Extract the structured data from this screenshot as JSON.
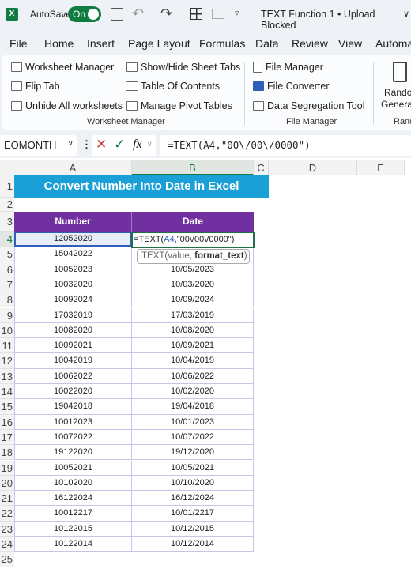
{
  "titlebar": {
    "autosave_label": "AutoSave",
    "toggle_label": "On",
    "doc_title": "TEXT Function 1 • Upload Blocked",
    "chevron": "∨"
  },
  "tabs": [
    "File",
    "Home",
    "Insert",
    "Page Layout",
    "Formulas",
    "Data",
    "Review",
    "View",
    "Automa"
  ],
  "ribbon": {
    "worksheet_group": {
      "label": "Worksheet Manager",
      "items": [
        "Worksheet Manager",
        "Flip Tab",
        "Unhide All worksheets",
        "Show/Hide Sheet Tabs",
        "Table Of Contents",
        "Manage Pivot Tables"
      ]
    },
    "file_group": {
      "label": "File Manager",
      "items": [
        "File Manager",
        "File Converter",
        "Data Segregation Tool"
      ]
    },
    "random_group": {
      "label": "Rand",
      "button_line1": "Randon",
      "button_line2": "Generat"
    }
  },
  "formula_bar": {
    "name_box": "EOMONTH",
    "fx": "fx",
    "formula": "=TEXT(A4,\"00\\/00\\/0000\")"
  },
  "columns": [
    "A",
    "B",
    "C",
    "D",
    "E"
  ],
  "sheet": {
    "title": "Convert Number Into Date in Excel",
    "headers": [
      "Number",
      "Date"
    ],
    "editing_formula_prefix": "=TEXT(",
    "editing_formula_ref": "A4",
    "editing_formula_suffix": ",\"00\\/00\\/0000\")",
    "tooltip_fn": "TEXT(value, ",
    "tooltip_arg": "format_text",
    "tooltip_close": ")",
    "rows": [
      [
        "12052020",
        ""
      ],
      [
        "15042022",
        ""
      ],
      [
        "10052023",
        "10/05/2023"
      ],
      [
        "10032020",
        "10/03/2020"
      ],
      [
        "10092024",
        "10/09/2024"
      ],
      [
        "17032019",
        "17/03/2019"
      ],
      [
        "10082020",
        "10/08/2020"
      ],
      [
        "10092021",
        "10/09/2021"
      ],
      [
        "10042019",
        "10/04/2019"
      ],
      [
        "10062022",
        "10/06/2022"
      ],
      [
        "10022020",
        "10/02/2020"
      ],
      [
        "19042018",
        "19/04/2018"
      ],
      [
        "10012023",
        "10/01/2023"
      ],
      [
        "10072022",
        "10/07/2022"
      ],
      [
        "19122020",
        "19/12/2020"
      ],
      [
        "10052021",
        "10/05/2021"
      ],
      [
        "10102020",
        "10/10/2020"
      ],
      [
        "16122024",
        "16/12/2024"
      ],
      [
        "10012217",
        "10/01/2217"
      ],
      [
        "10122015",
        "10/12/2015"
      ],
      [
        "10122014",
        "10/12/2014"
      ]
    ],
    "row_numbers": [
      "1",
      "2",
      "3",
      "4",
      "5",
      "6",
      "7",
      "8",
      "9",
      "10",
      "11",
      "12",
      "13",
      "14",
      "15",
      "16",
      "17",
      "18",
      "19",
      "20",
      "21",
      "22",
      "23",
      "24",
      "25"
    ]
  },
  "colors": {
    "title_bg": "#1a9fd6",
    "header_bg": "#7030a0",
    "excel_green": "#107c41",
    "cell_border": "#c9c3e8"
  }
}
